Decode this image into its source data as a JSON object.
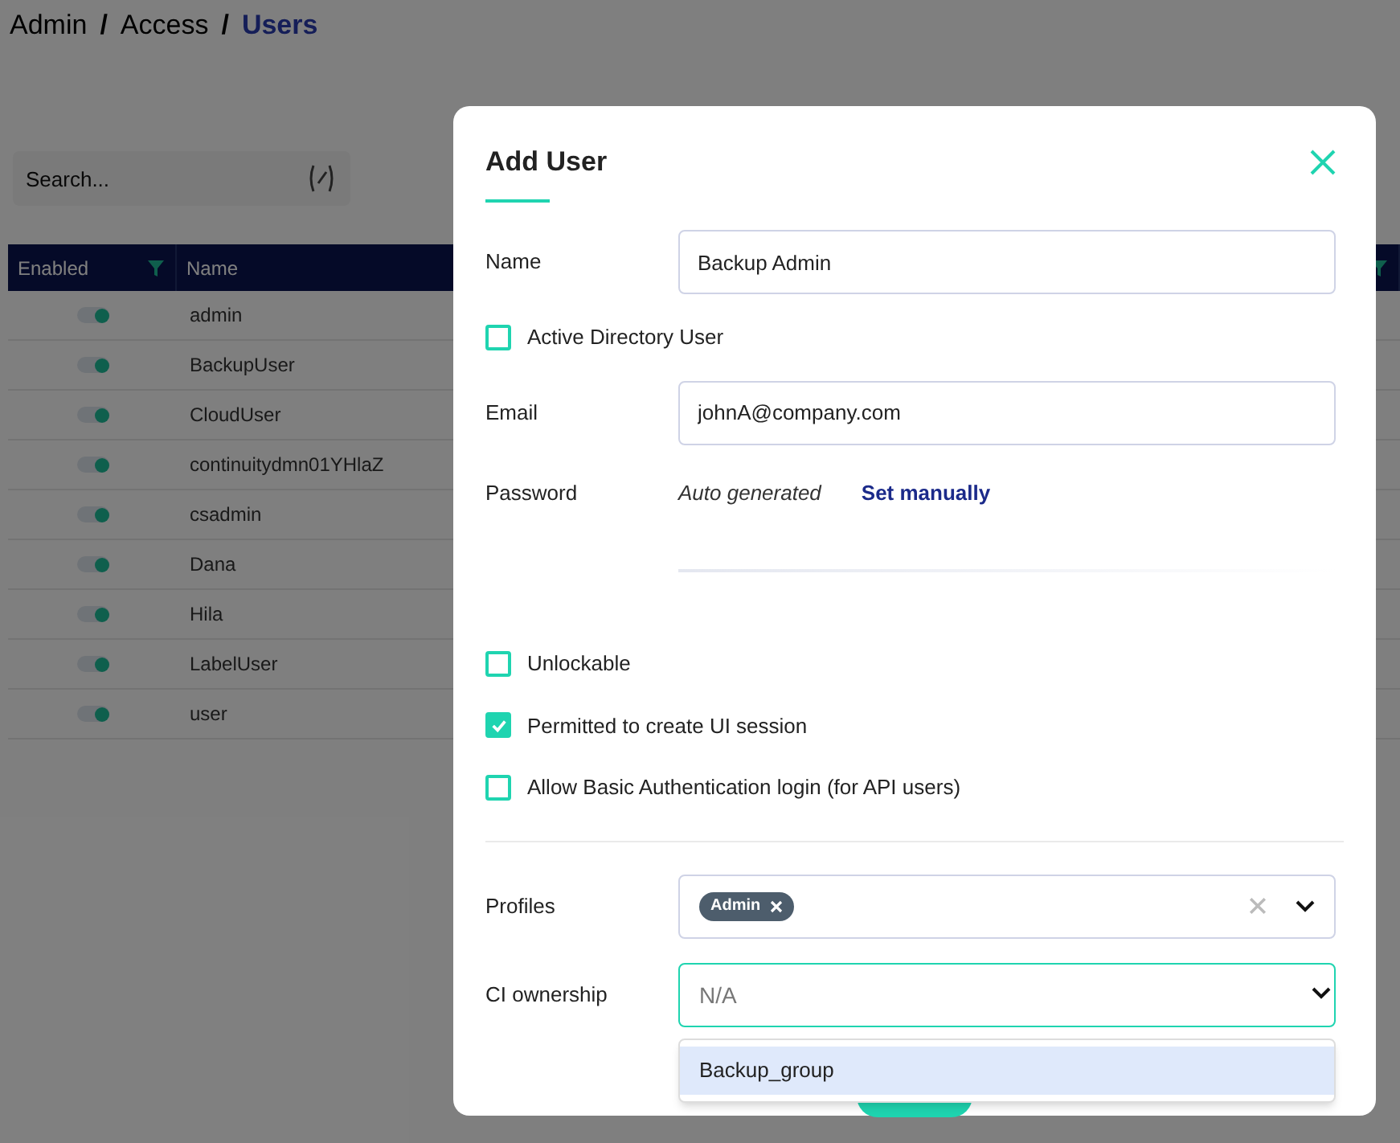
{
  "breadcrumb": [
    {
      "label": "Admin",
      "separator": "/",
      "current": false
    },
    {
      "label": "Access",
      "separator": "/",
      "current": false
    },
    {
      "label": "Users",
      "current": true
    }
  ],
  "search": {
    "placeholder": "Search..."
  },
  "table": {
    "columns": [
      "Enabled",
      "Name"
    ],
    "rows": [
      {
        "enabled": true,
        "name": "admin"
      },
      {
        "enabled": true,
        "name": "BackupUser"
      },
      {
        "enabled": true,
        "name": "CloudUser"
      },
      {
        "enabled": true,
        "name": "continuitydmn01YHlaZ"
      },
      {
        "enabled": true,
        "name": "csadmin"
      },
      {
        "enabled": true,
        "name": "Dana"
      },
      {
        "enabled": true,
        "name": "Hila"
      },
      {
        "enabled": true,
        "name": "LabelUser"
      },
      {
        "enabled": true,
        "name": "user"
      }
    ]
  },
  "dialog": {
    "title": "Add User",
    "name": {
      "label": "Name",
      "value": "Backup Admin"
    },
    "active_directory": {
      "label": "Active Directory User",
      "checked": false
    },
    "email": {
      "label": "Email",
      "value": "johnA@company.com"
    },
    "password": {
      "label": "Password",
      "hint": "Auto generated",
      "link": "Set manually"
    },
    "options": [
      {
        "label": "Unlockable",
        "checked": false
      },
      {
        "label": "Permitted to create UI session",
        "checked": true
      },
      {
        "label": "Allow Basic Authentication login (for API users)",
        "checked": false
      }
    ],
    "profiles": {
      "label": "Profiles",
      "tags": [
        "Admin"
      ]
    },
    "ci_ownership": {
      "label": "CI ownership",
      "placeholder": "N/A",
      "focused": true,
      "options": [
        {
          "label": "Backup_group",
          "highlighted": true
        }
      ]
    }
  }
}
